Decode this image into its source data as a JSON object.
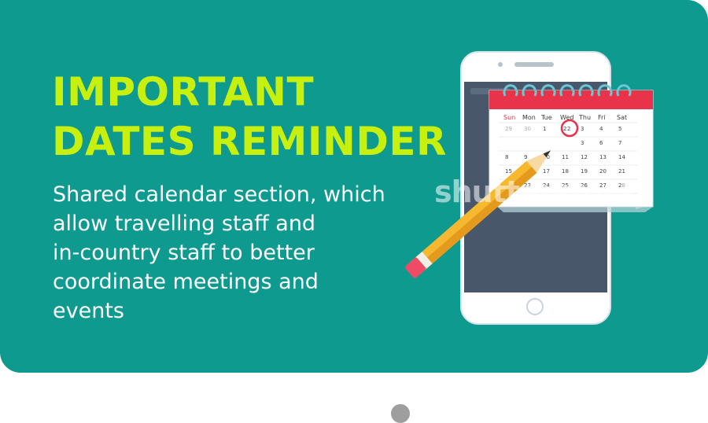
{
  "slide": {
    "title_lines": [
      "IMPORTANT",
      "DATES REMINDER"
    ],
    "description_lines": [
      "Shared calendar section, which",
      "allow travelling staff and",
      "in-country staff to better",
      "coordinate meetings and",
      "events"
    ],
    "watermark": "shutterstock"
  },
  "calendar": {
    "weekdays": [
      "Sun",
      "Mon",
      "Tue",
      "Wed",
      "Thu",
      "Fri",
      "Sat"
    ],
    "rows": [
      [
        "29",
        "30",
        "1",
        "2",
        "3",
        "4",
        "5"
      ],
      [
        "",
        "",
        "",
        "",
        "3",
        "6",
        "7"
      ],
      [
        "8",
        "9",
        "10",
        "11",
        "12",
        "13",
        "14"
      ],
      [
        "15",
        "16",
        "17",
        "18",
        "19",
        "20",
        "21"
      ],
      [
        "22",
        "23",
        "24",
        "25",
        "26",
        "27",
        "28"
      ]
    ],
    "circled_day": "2"
  },
  "colors": {
    "background": "#0f9a90",
    "title": "#c8f00f",
    "calendar_header": "#e8334a",
    "pencil": "#f5b82e"
  },
  "pagination": {
    "total": 1,
    "active": 1
  }
}
